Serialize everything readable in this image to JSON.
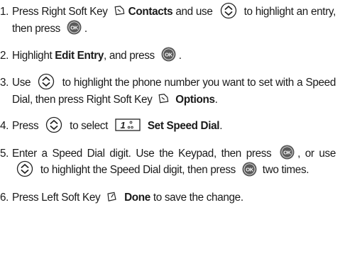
{
  "steps": [
    {
      "num": "1.",
      "t1": "Press Right Soft Key",
      "b1": "Contacts",
      "t2": "and use",
      "t3": "to highlight an entry, then press",
      "t4": "."
    },
    {
      "num": "2.",
      "t1": "Highlight",
      "b1": "Edit Entry",
      "t2": ", and press",
      "t3": "."
    },
    {
      "num": "3.",
      "t1": "Use",
      "t2": "to highlight the phone number you want to set with a Speed Dial, then press Right Soft Key",
      "b1": "Options",
      "t3": "."
    },
    {
      "num": "4.",
      "t1": "Press",
      "t2": "to select",
      "b1": "Set Speed Dial",
      "t3": "."
    },
    {
      "num": "5.",
      "t1": "Enter a Speed Dial digit. Use the Keypad, then press",
      "t2": ", or use",
      "t3": "to highlight the Speed Dial digit, then press",
      "t4": "two times."
    },
    {
      "num": "6.",
      "t1": "Press Left Soft Key",
      "b1": "Done",
      "t2": "to save the change."
    }
  ],
  "icons": {
    "ok_label": "OK",
    "speed_dial_key": "1",
    "colors": {
      "ok_button": "#5a5a5a",
      "icon_stroke": "#222222"
    }
  }
}
